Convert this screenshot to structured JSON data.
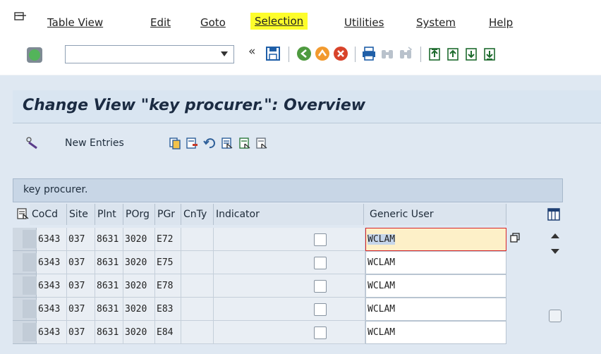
{
  "menubar": {
    "items": [
      "Table View",
      "Edit",
      "Goto",
      "Selection",
      "Utilities",
      "System",
      "Help"
    ],
    "highlight_color": "#fdfd2b"
  },
  "toolbar": {
    "command_field_value": "",
    "icons": [
      "enter-icon",
      "dropdown-icon",
      "collapse-icon",
      "save-icon",
      "back-icon",
      "exit-icon",
      "cancel-icon",
      "print-icon",
      "find-icon",
      "find-next-icon",
      "first-page-icon",
      "previous-page-icon",
      "next-page-icon",
      "last-page-icon"
    ],
    "chevron": "«"
  },
  "page": {
    "title": "Change View \"key procurer.\": Overview"
  },
  "app_toolbar": {
    "new_entries_label": "New Entries",
    "icons": [
      "display-change-icon",
      "copy-as-icon",
      "delete-icon",
      "undo-change-icon",
      "select-all-icon",
      "select-block-icon",
      "deselect-all-icon"
    ]
  },
  "table": {
    "title": "key procurer.",
    "columns": [
      "CoCd",
      "Site",
      "Plnt",
      "POrg",
      "PGr",
      "CnTy",
      "Indicator",
      "Generic User"
    ],
    "rows": [
      {
        "cocd": "6343",
        "site": "037",
        "plnt": "8631",
        "porg": "3020",
        "pgr": "E72",
        "cnty": "",
        "indicator": false,
        "generic_user": "WCLAM"
      },
      {
        "cocd": "6343",
        "site": "037",
        "plnt": "8631",
        "porg": "3020",
        "pgr": "E75",
        "cnty": "",
        "indicator": false,
        "generic_user": "WCLAM"
      },
      {
        "cocd": "6343",
        "site": "037",
        "plnt": "8631",
        "porg": "3020",
        "pgr": "E78",
        "cnty": "",
        "indicator": false,
        "generic_user": "WCLAM"
      },
      {
        "cocd": "6343",
        "site": "037",
        "plnt": "8631",
        "porg": "3020",
        "pgr": "E83",
        "cnty": "",
        "indicator": false,
        "generic_user": "WCLAM"
      },
      {
        "cocd": "6343",
        "site": "037",
        "plnt": "8631",
        "porg": "3020",
        "pgr": "E84",
        "cnty": "",
        "indicator": false,
        "generic_user": "WCLAM"
      }
    ],
    "active_row": 0,
    "active_border_color": "#d8232a"
  }
}
